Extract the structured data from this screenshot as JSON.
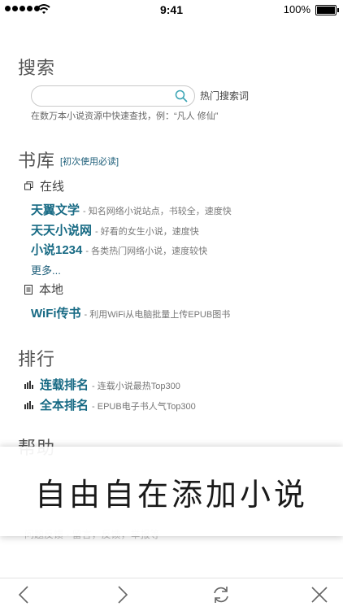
{
  "status": {
    "time": "9:41",
    "battery": "100%"
  },
  "search": {
    "title": "搜索",
    "placeholder": "",
    "hot_label": "热门搜索词",
    "hint": "在数万本小说资源中快速查找，例：“凡人 修仙”"
  },
  "library": {
    "title": "书库",
    "guide": "[初次使用必读]",
    "online_label": "在线",
    "online_items": [
      {
        "title": "天翼文学",
        "desc": "- 知名网络小说站点，书较全，速度快"
      },
      {
        "title": "天天小说网",
        "desc": "- 好看的女生小说，速度快"
      },
      {
        "title": "小说1234",
        "desc": "- 各类热门网络小说，速度较快"
      }
    ],
    "more": "更多...",
    "local_label": "本地",
    "local_items": [
      {
        "title": "WiFi传书",
        "desc": "- 利用WiFi从电脑批量上传EPUB图书"
      }
    ]
  },
  "ranking": {
    "title": "排行",
    "items": [
      {
        "title": "连载排名",
        "desc": "- 连载小说最热Top300"
      },
      {
        "title": "全本排名",
        "desc": "- EPUB电子书人气Top300"
      }
    ]
  },
  "help": {
    "title": "帮助",
    "last_item": "问题反馈 - 留言，反馈，举报等"
  },
  "banner": {
    "text": "自由自在添加小说"
  },
  "colors": {
    "link": "#176a84",
    "text": "#555555"
  }
}
